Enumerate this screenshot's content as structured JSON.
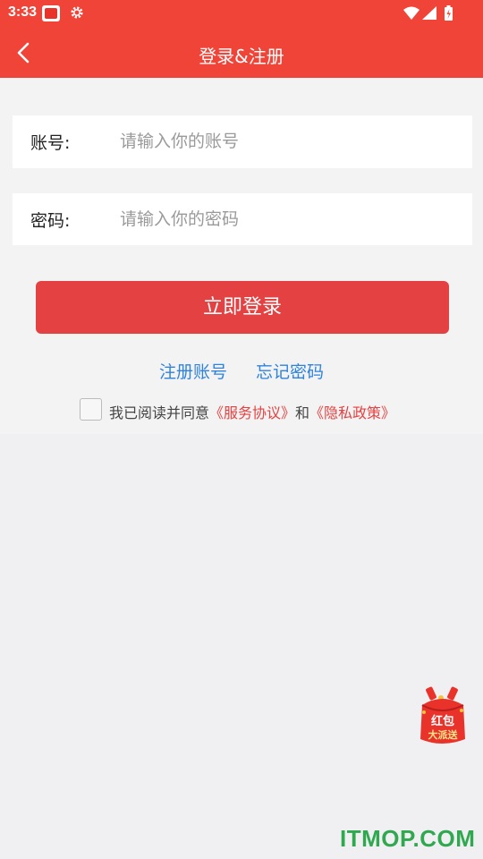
{
  "status_bar": {
    "time": "3:33",
    "icons": [
      "app-notification-icon",
      "gear-icon",
      "wifi-icon",
      "signal-icon",
      "battery-icon"
    ]
  },
  "title_bar": {
    "back_icon": "chevron-left-icon",
    "title": "登录&注册"
  },
  "form": {
    "account": {
      "label": "账号:",
      "placeholder": "请输入你的账号",
      "value": ""
    },
    "password": {
      "label": "密码:",
      "placeholder": "请输入你的密码",
      "value": ""
    },
    "login_button": "立即登录",
    "register_link": "注册账号",
    "forgot_link": "忘记密码",
    "agreement": {
      "checked": false,
      "prefix": "我已阅读并同意",
      "service_link": "《服务协议》",
      "conjunction": "和",
      "privacy_link": "《隐私政策》"
    }
  },
  "floating_promo": {
    "text_line1": "红包",
    "text_line2": "大派送"
  },
  "watermark": "ITMOP.COM",
  "colors": {
    "header": "#f04438",
    "button": "#e44242",
    "link_blue": "#2f83dc",
    "link_red": "#e44242",
    "watermark": "#2fa84f"
  }
}
